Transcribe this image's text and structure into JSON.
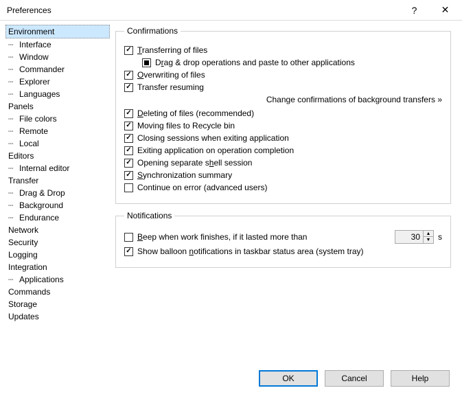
{
  "title": "Preferences",
  "tree": {
    "environment": "Environment",
    "interface": "Interface",
    "window": "Window",
    "commander": "Commander",
    "explorer": "Explorer",
    "languages": "Languages",
    "panels": "Panels",
    "filecolors": "File colors",
    "remote": "Remote",
    "local": "Local",
    "editors": "Editors",
    "internaleditor": "Internal editor",
    "transfer": "Transfer",
    "dragdrop": "Drag & Drop",
    "background": "Background",
    "endurance": "Endurance",
    "network": "Network",
    "security": "Security",
    "logging": "Logging",
    "integration": "Integration",
    "applications": "Applications",
    "commands": "Commands",
    "storage": "Storage",
    "updates": "Updates"
  },
  "confirmations": {
    "legend": "Confirmations",
    "transferring": "Transferring of files",
    "dragdrop": "Drag & drop operations and paste to other applications",
    "overwriting": "Overwriting of files",
    "resuming": "Transfer resuming",
    "link": "Change confirmations of background transfers »",
    "deleting": "Deleting of files (recommended)",
    "moving": "Moving files to Recycle bin",
    "closing": "Closing sessions when exiting application",
    "exiting": "Exiting application on operation completion",
    "opening": "Opening separate shell session",
    "sync": "Synchronization summary",
    "continue": "Continue on error (advanced users)"
  },
  "notifications": {
    "legend": "Notifications",
    "beep": "Beep when work finishes, if it lasted more than",
    "beep_seconds": "30",
    "beep_unit": "s",
    "balloon": "Show balloon notifications in taskbar status area (system tray)"
  },
  "buttons": {
    "ok": "OK",
    "cancel": "Cancel",
    "help": "Help"
  }
}
